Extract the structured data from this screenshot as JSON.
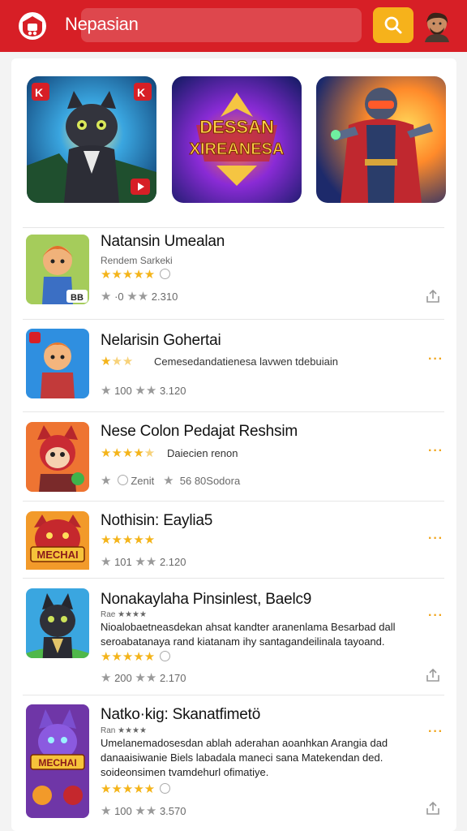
{
  "header": {
    "search_text": "Nepasian",
    "brand_color": "#d71f26",
    "search_button_color": "#f6b21b"
  },
  "banners": [
    {
      "name": "cat-hero-banner"
    },
    {
      "name": "game-title-banner",
      "text_line1": "DESSAN",
      "text_line2": "XIREANESA"
    },
    {
      "name": "space-hero-banner"
    }
  ],
  "apps": [
    {
      "title": "Natansin Umealan",
      "subtitle": "Rendem Sarkeki",
      "rating": 5,
      "meta_a": "0",
      "meta_b": "2.310",
      "icon_badge": "BB"
    },
    {
      "title": "Nelarisin Gohertai",
      "desc_inline": "Cemesedandatienesa lavwen tdebuiain",
      "rating": 3,
      "meta_a": "100",
      "meta_b": "3.120"
    },
    {
      "title": "Nese Colon Pedajat Reshsim",
      "desc_inline": "Daiecien renon",
      "rating": 4,
      "meta_a": "Zenit",
      "meta_b": "56 80Sodora"
    },
    {
      "title": "Nothisin: Eaylia5",
      "rating": 5,
      "meta_a": "101",
      "meta_b": "2.120",
      "icon_badge": "MECHAI"
    },
    {
      "title": "Nonakaylaha Pinsinlest, Baelc9",
      "subtitle": "Rae ★★★★",
      "desc": "Nioalobaetneasdekan ahsat kandter aranenlama Besarbad dall seroabatanaya rand kiatanam ihy santagandeilinala tayoand.",
      "rating": 5,
      "meta_a": "200",
      "meta_b": "2.170"
    },
    {
      "title": "Natko·kig: Skanatfimetö",
      "subtitle": "Ran ★★★★",
      "desc": "Umelanemadosesdan ablah aderahan aoanhkan Arangia dad danaaisiwanie Biels labadala maneci sana Matekendan ded. soideonsimen tvamdehurl ofimatiye.",
      "rating": 5,
      "meta_a": "100",
      "meta_b": "3.570",
      "icon_badge": "MECHAI"
    }
  ]
}
